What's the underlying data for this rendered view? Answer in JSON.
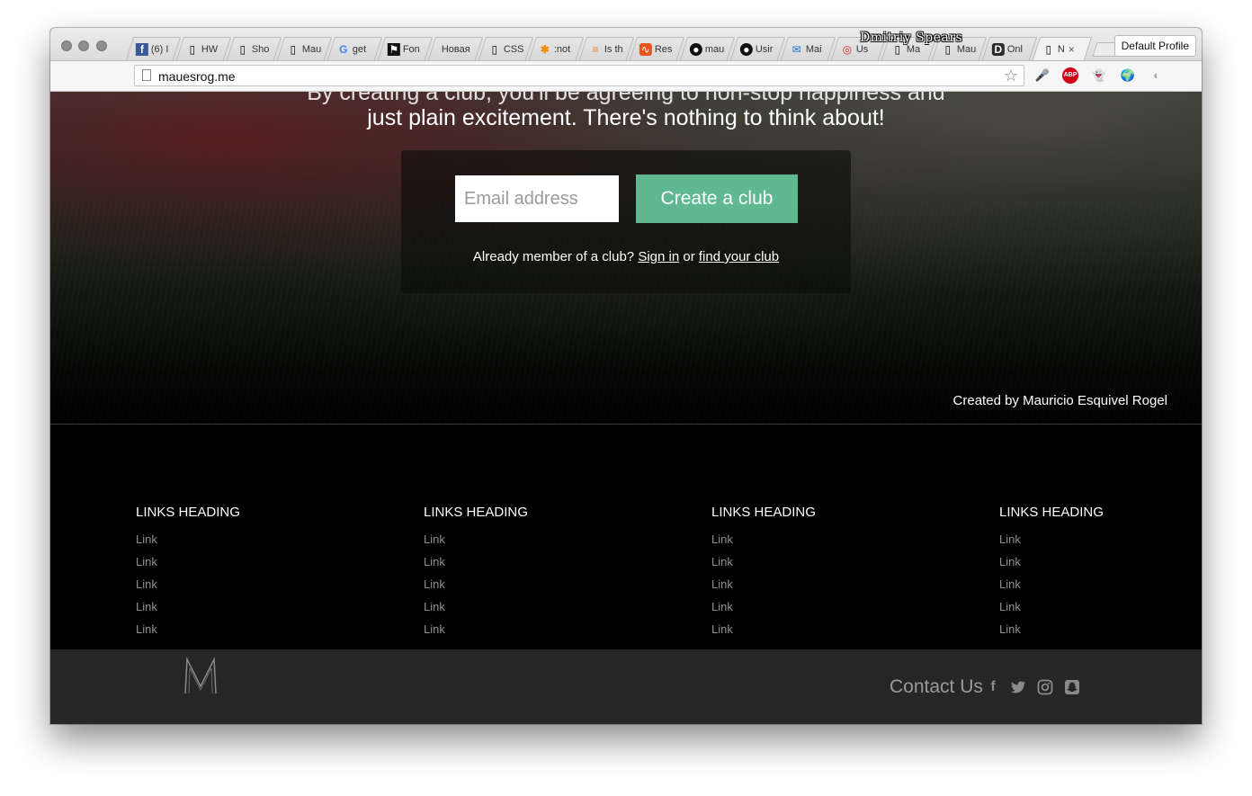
{
  "browser": {
    "tabs": [
      {
        "title": "(6) I",
        "icon": "facebook-icon"
      },
      {
        "title": "HW",
        "icon": "page-icon"
      },
      {
        "title": "Sho",
        "icon": "page-icon"
      },
      {
        "title": "Mau",
        "icon": "page-icon"
      },
      {
        "title": "get",
        "icon": "google-icon"
      },
      {
        "title": "Fon",
        "icon": "flag-icon"
      },
      {
        "title": "Новая",
        "icon": "none"
      },
      {
        "title": "CSS",
        "icon": "page-icon"
      },
      {
        "title": ":not",
        "icon": "asterisk-icon"
      },
      {
        "title": "Is th",
        "icon": "stackoverflow-icon"
      },
      {
        "title": "Res",
        "icon": "chart-icon"
      },
      {
        "title": "mau",
        "icon": "github-icon"
      },
      {
        "title": "Usir",
        "icon": "github-icon"
      },
      {
        "title": "Mai",
        "icon": "mail-icon"
      },
      {
        "title": "Us",
        "icon": "lifebuoy-icon"
      },
      {
        "title": "Ma",
        "icon": "page-icon"
      },
      {
        "title": "Mau",
        "icon": "page-icon"
      },
      {
        "title": "Onl",
        "icon": "d-icon"
      },
      {
        "title": "N",
        "icon": "page-icon",
        "active": true
      }
    ],
    "close_glyph": "×",
    "profile_label": "Default Profile",
    "overlay_name": "Dmitriy Spears",
    "url": "mauesrog.me"
  },
  "hero": {
    "tagline_cut": "By creating a club, you'll be agreeing to non-stop happiness and",
    "tagline": "just plain excitement. There's nothing to think about!",
    "email_placeholder": "Email address",
    "create_button": "Create a club",
    "member_prefix": "Already member of a club?",
    "sign_in": "Sign in",
    "member_or": "or",
    "find_club": "find your club",
    "credit": "Created by Mauricio Esquivel Rogel"
  },
  "footer": {
    "columns": [
      {
        "heading": "LINKS HEADING",
        "links": [
          "Link",
          "Link",
          "Link",
          "Link",
          "Link"
        ]
      },
      {
        "heading": "LINKS HEADING",
        "links": [
          "Link",
          "Link",
          "Link",
          "Link",
          "Link"
        ]
      },
      {
        "heading": "LINKS HEADING",
        "links": [
          "Link",
          "Link",
          "Link",
          "Link",
          "Link"
        ]
      },
      {
        "heading": "LINKS HEADING",
        "links": [
          "Link",
          "Link",
          "Link",
          "Link",
          "Link"
        ]
      }
    ],
    "contact": "Contact Us",
    "social_icons": [
      "facebook-icon",
      "twitter-icon",
      "instagram-icon",
      "snapchat-icon"
    ],
    "accent_color": "#5fb88f"
  }
}
